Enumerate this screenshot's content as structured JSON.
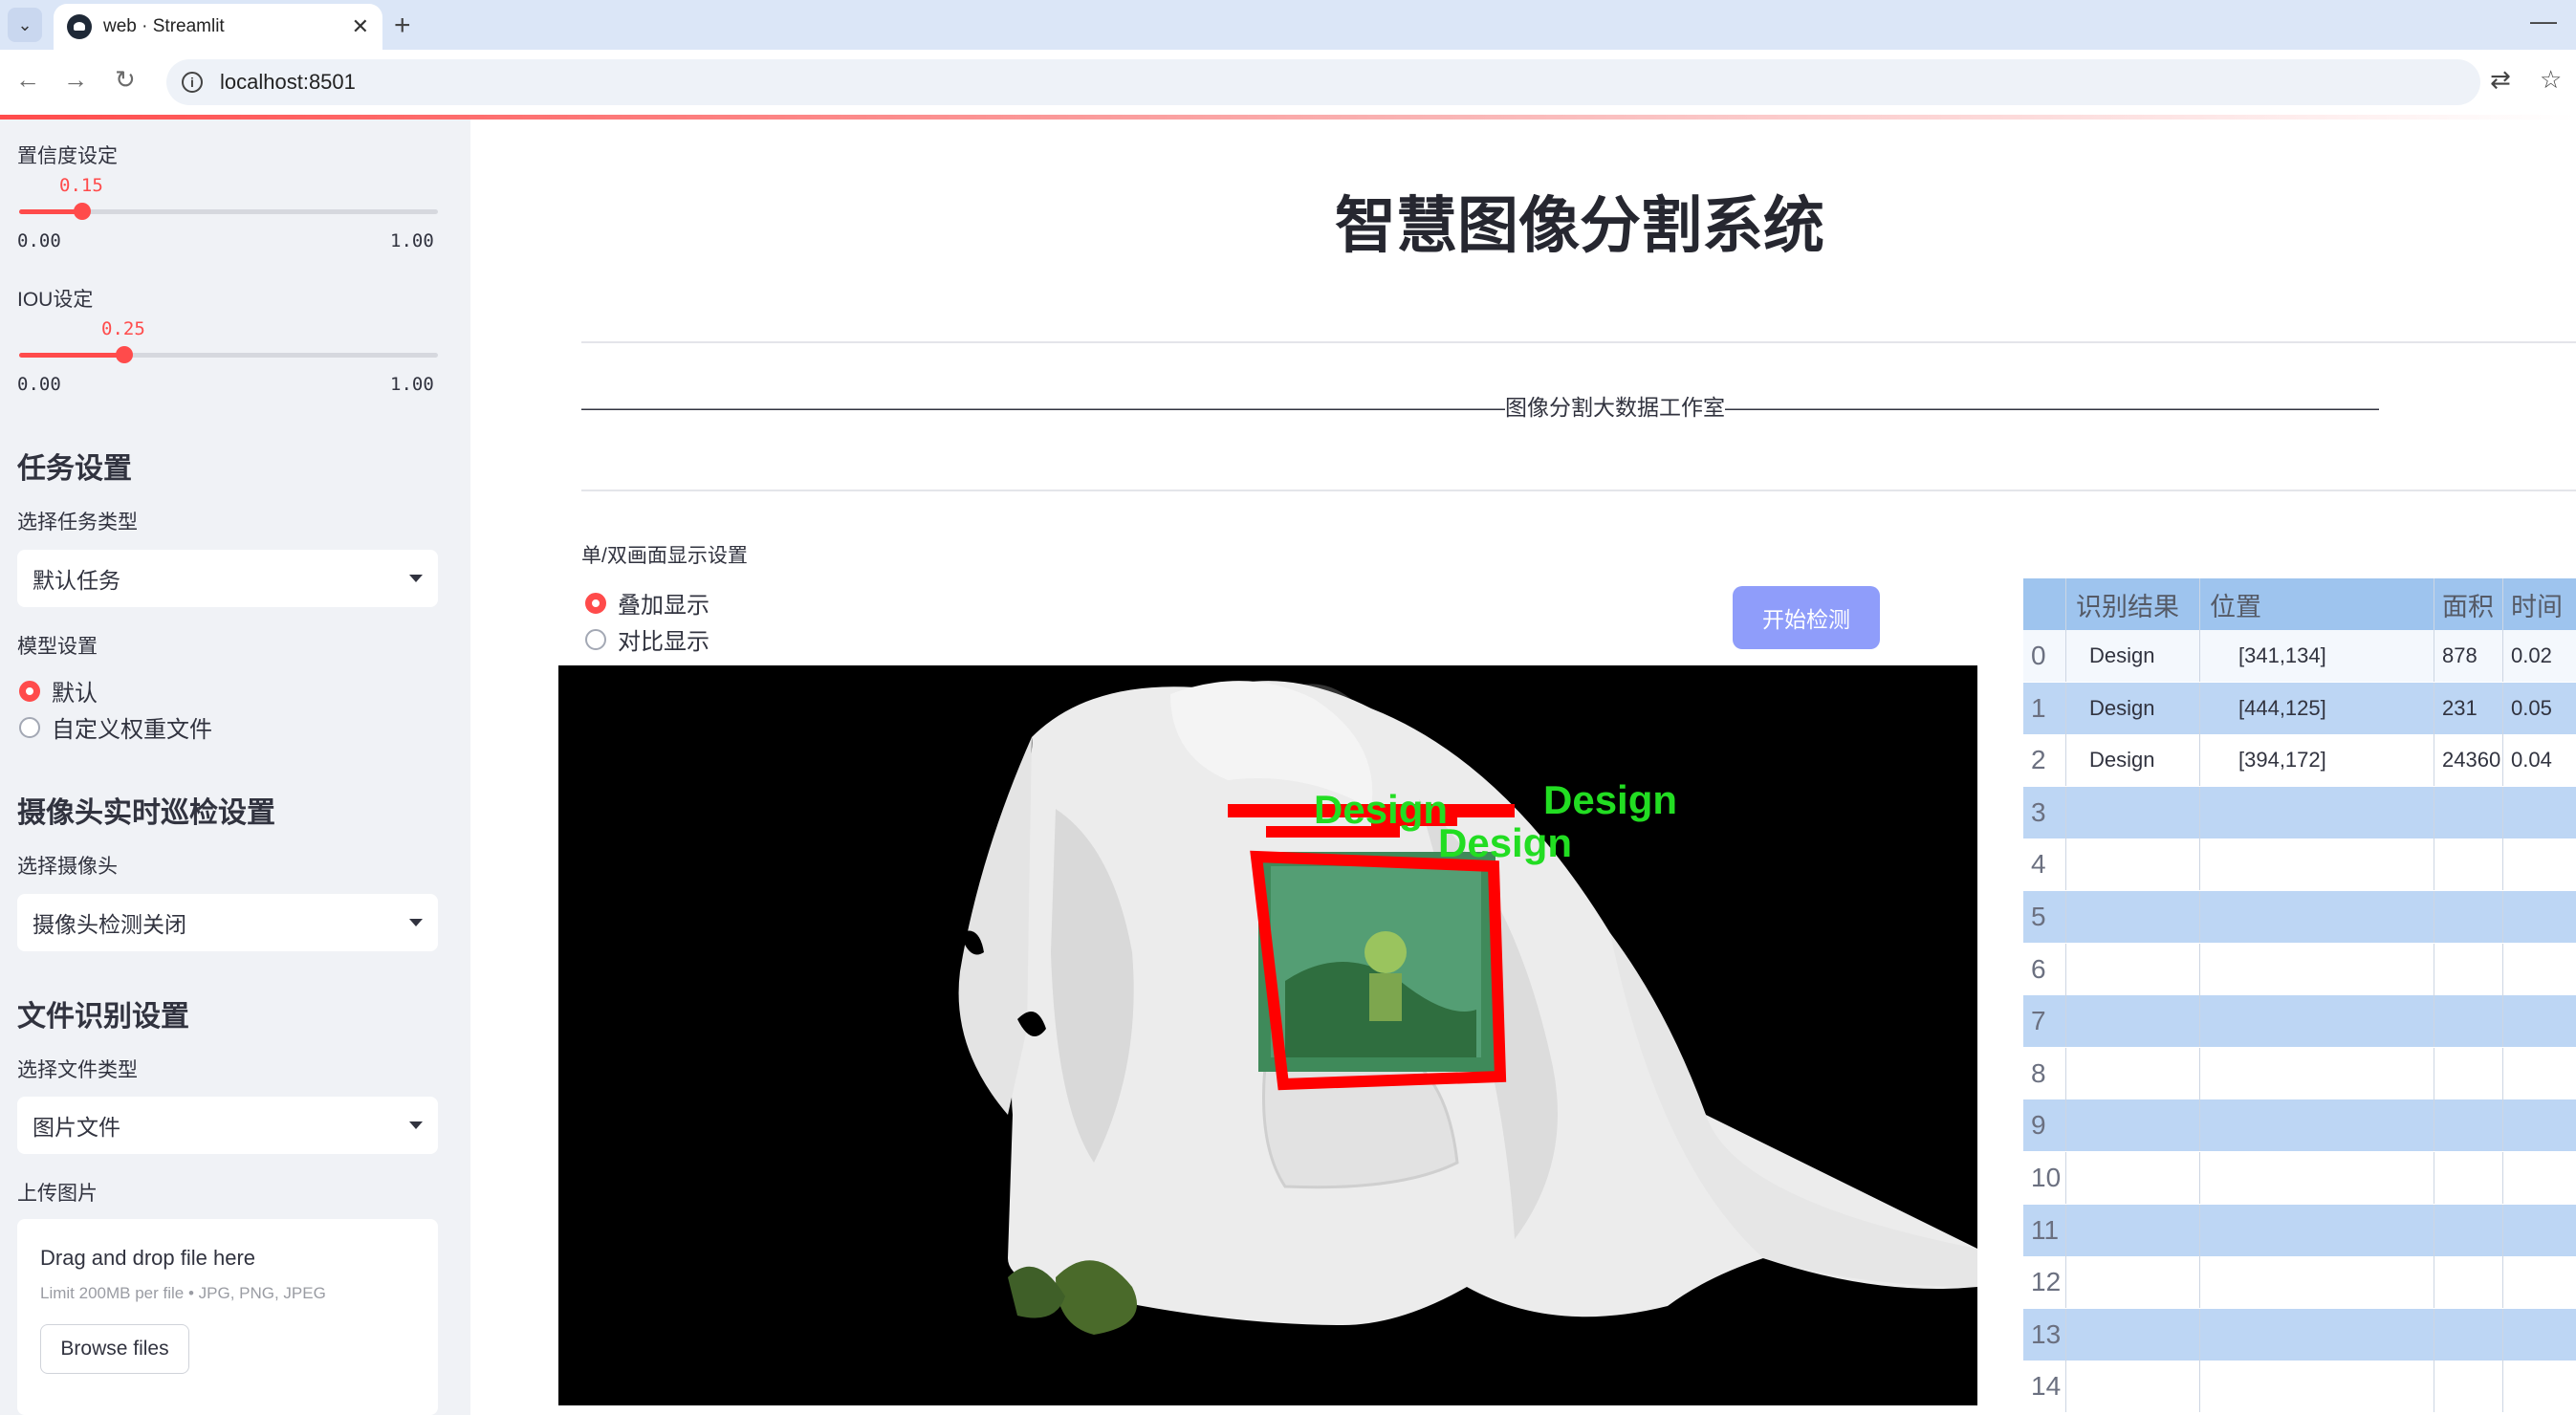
{
  "browser": {
    "tab_title": "web · Streamlit",
    "url": "localhost:8501"
  },
  "sidebar": {
    "conf_label": "置信度设定",
    "conf_value": "0.15",
    "conf_fraction": 0.15,
    "conf_min": "0.00",
    "conf_max": "1.00",
    "iou_label": "IOU设定",
    "iou_value": "0.25",
    "iou_fraction": 0.25,
    "iou_min": "0.00",
    "iou_max": "1.00",
    "task_heading": "任务设置",
    "task_type_label": "选择任务类型",
    "task_type_value": "默认任务",
    "model_label": "模型设置",
    "model_options": [
      "默认",
      "自定义权重文件"
    ],
    "model_selected": 0,
    "camera_heading": "摄像头实时巡检设置",
    "camera_label": "选择摄像头",
    "camera_value": "摄像头检测关闭",
    "file_heading": "文件识别设置",
    "file_type_label": "选择文件类型",
    "file_type_value": "图片文件",
    "upload_label": "上传图片",
    "drop_title": "Drag and drop file here",
    "drop_limit": "Limit 200MB per file • JPG, PNG, JPEG",
    "browse_label": "Browse files"
  },
  "main": {
    "title": "智慧图像分割系统",
    "studio_line": "——————————————————————————————————————————图像分割大数据工作室——————————————————————————————————————————",
    "display_label": "单/双画面显示设置",
    "display_options": [
      "叠加显示",
      "对比显示"
    ],
    "display_selected": 0,
    "start_button": "开始检测",
    "detections": [
      {
        "label": "Design"
      },
      {
        "label": "Design"
      },
      {
        "label": "Design"
      }
    ]
  },
  "table": {
    "headers": [
      "识别结果",
      "位置",
      "面积",
      "时间"
    ],
    "rows": [
      {
        "idx": "0",
        "result": "Design",
        "pos": "[341,134]",
        "area": "878",
        "time": "0.02"
      },
      {
        "idx": "1",
        "result": "Design",
        "pos": "[444,125]",
        "area": "231",
        "time": "0.05"
      },
      {
        "idx": "2",
        "result": "Design",
        "pos": "[394,172]",
        "area": "24360",
        "time": "0.04"
      },
      {
        "idx": "3",
        "result": "",
        "pos": "",
        "area": "",
        "time": ""
      },
      {
        "idx": "4",
        "result": "",
        "pos": "",
        "area": "",
        "time": ""
      },
      {
        "idx": "5",
        "result": "",
        "pos": "",
        "area": "",
        "time": ""
      },
      {
        "idx": "6",
        "result": "",
        "pos": "",
        "area": "",
        "time": ""
      },
      {
        "idx": "7",
        "result": "",
        "pos": "",
        "area": "",
        "time": ""
      },
      {
        "idx": "8",
        "result": "",
        "pos": "",
        "area": "",
        "time": ""
      },
      {
        "idx": "9",
        "result": "",
        "pos": "",
        "area": "",
        "time": ""
      },
      {
        "idx": "10",
        "result": "",
        "pos": "",
        "area": "",
        "time": ""
      },
      {
        "idx": "11",
        "result": "",
        "pos": "",
        "area": "",
        "time": ""
      },
      {
        "idx": "12",
        "result": "",
        "pos": "",
        "area": "",
        "time": ""
      },
      {
        "idx": "13",
        "result": "",
        "pos": "",
        "area": "",
        "time": ""
      },
      {
        "idx": "14",
        "result": "",
        "pos": "",
        "area": "",
        "time": ""
      }
    ]
  },
  "colors": {
    "accent": "#ff4b4b",
    "button": "#8f9dfa",
    "table_header": "#9ec4ee",
    "table_row_alt": "#bdd6f4",
    "detection_box": "#ff0000",
    "detection_text": "#22dd22"
  }
}
